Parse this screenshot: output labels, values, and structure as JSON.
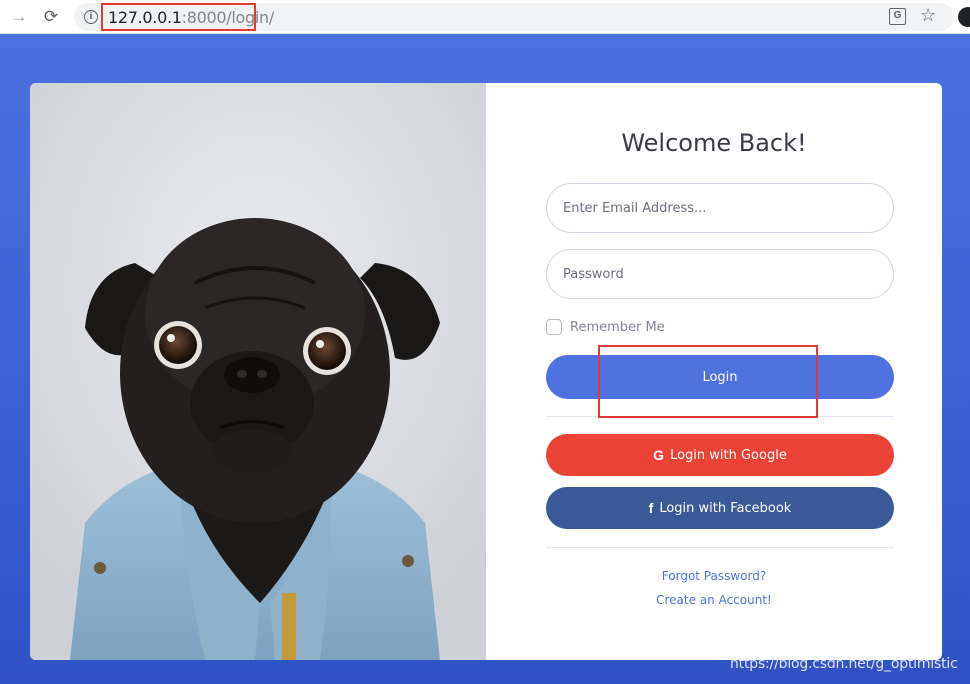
{
  "browser": {
    "url_host": "127.0.0.1",
    "url_rest": ":8000/login/"
  },
  "login_form": {
    "title": "Welcome Back!",
    "email_placeholder": "Enter Email Address...",
    "password_placeholder": "Password",
    "remember_label": "Remember Me",
    "login_label": "Login",
    "google_icon": "G",
    "google_label": "Login with Google",
    "facebook_icon": "f",
    "facebook_label": "Login with Facebook",
    "forgot_label": "Forgot Password?",
    "create_label": "Create an Account!"
  },
  "photo": {
    "subject": "pug-in-denim-jacket-image"
  },
  "watermark": "https://blog.csdn.net/g_optimistic",
  "colors": {
    "background": "#4e73df",
    "primary": "#4e73df",
    "google": "#ea4335",
    "facebook": "#3b5998",
    "annotation": "#e53935"
  }
}
